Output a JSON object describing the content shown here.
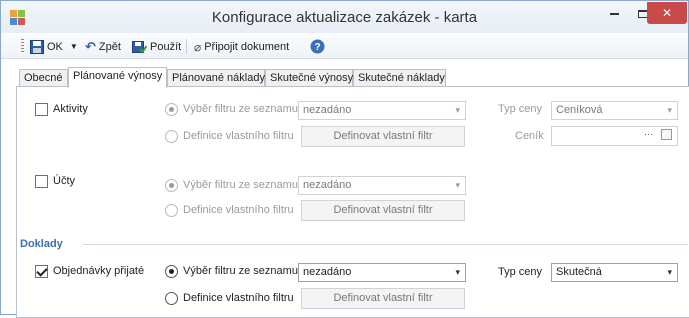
{
  "window": {
    "title": "Konfigurace aktualizace zakázek - karta",
    "close_glyph": "✕"
  },
  "toolbar": {
    "ok_label": "OK",
    "back_label": "Zpět",
    "apply_label": "Použít",
    "attach_label": "Připojit dokument"
  },
  "tabs": [
    {
      "label": "Obecné"
    },
    {
      "label": "Plánované výnosy"
    },
    {
      "label": "Plánované náklady"
    },
    {
      "label": "Skutečné výnosy"
    },
    {
      "label": "Skutečné náklady"
    }
  ],
  "active_tab": "Plánované výnosy",
  "aktivity": {
    "label": "Aktivity",
    "checked": false,
    "radio_list": "Výběr filtru ze seznamu",
    "radio_custom": "Definice vlastního filtru",
    "filter_value": "nezadáno",
    "define_button": "Definovat vlastní filtr",
    "price_type_label": "Typ ceny",
    "price_type_value": "Ceníková",
    "pricelist_label": "Ceník",
    "pricelist_value": "",
    "ellipsis": "···"
  },
  "ucty": {
    "label": "Účty",
    "checked": false,
    "radio_list": "Výběr filtru ze seznamu",
    "radio_custom": "Definice vlastního filtru",
    "filter_value": "nezadáno",
    "define_button": "Definovat vlastní filtr"
  },
  "doklady": {
    "section_title": "Doklady",
    "label": "Objednávky přijaté",
    "checked": true,
    "radio_list": "Výběr filtru ze seznamu",
    "radio_custom": "Definice vlastního filtru",
    "filter_value": "nezadáno",
    "define_button": "Definovat vlastní filtr",
    "price_type_label": "Typ ceny",
    "price_type_value": "Skutečná"
  }
}
